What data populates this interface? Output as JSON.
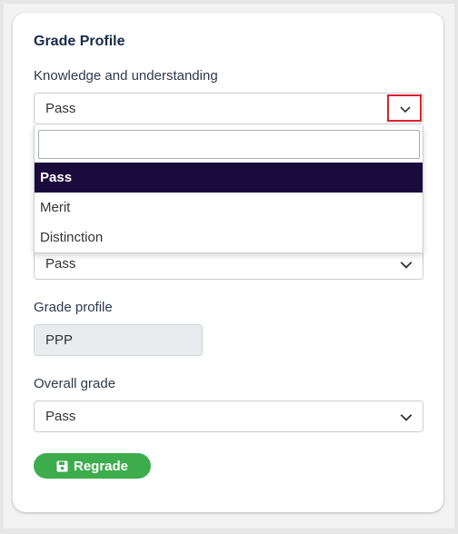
{
  "form": {
    "heading": "Grade Profile",
    "knowledge": {
      "label": "Knowledge and understanding",
      "value": "Pass",
      "search_value": "",
      "options": [
        "Pass",
        "Merit",
        "Distinction"
      ],
      "selected_option": "Pass"
    },
    "second_select": {
      "value": "Pass"
    },
    "grade_profile": {
      "label": "Grade profile",
      "value": "PPP"
    },
    "overall": {
      "label": "Overall grade",
      "value": "Pass"
    },
    "regrade_button": {
      "label": "Regrade",
      "icon": "save-icon"
    }
  },
  "colors": {
    "heading": "#1b2a4a",
    "highlight_border": "#d9232e",
    "active_option_bg": "#1a0b3d",
    "button_bg": "#3cac4c"
  }
}
